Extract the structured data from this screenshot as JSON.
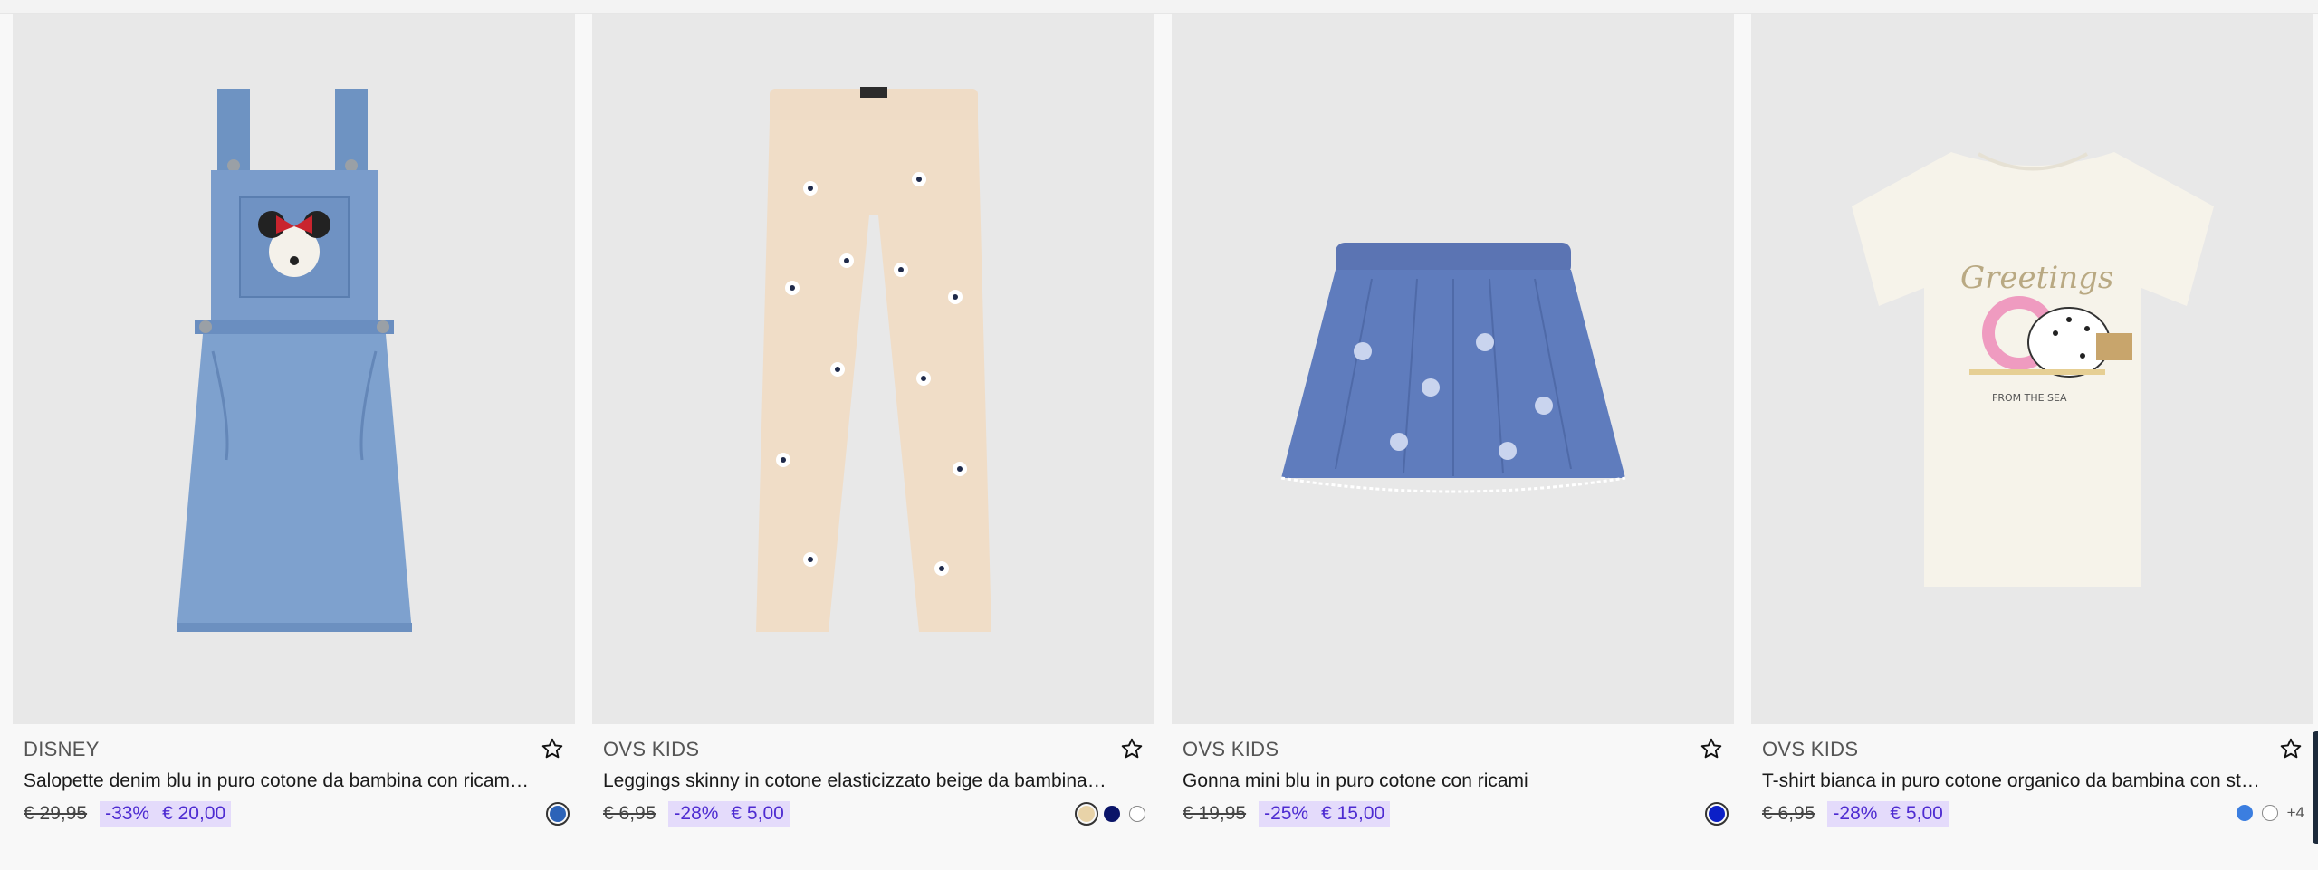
{
  "products": [
    {
      "brand": "DISNEY",
      "title": "Salopette denim blu in puro cotone da bambina con ricami Minnie",
      "old_price": "€ 29,95",
      "discount": "-33%",
      "price": "€ 20,00",
      "image_icon": "denim-dungaree-dress-image",
      "swatches": [
        {
          "color": "#2c63b8",
          "selected": true
        }
      ],
      "more": ""
    },
    {
      "brand": "OVS KIDS",
      "title": "Leggings skinny in cotone elasticizzato beige da bambina con fiori",
      "old_price": "€ 6,95",
      "discount": "-28%",
      "price": "€ 5,00",
      "image_icon": "floral-leggings-image",
      "swatches": [
        {
          "color": "#e8d3a8",
          "selected": true
        },
        {
          "color": "#0a1468",
          "selected": false
        },
        {
          "color": "#ffffff",
          "selected": false
        }
      ],
      "more": ""
    },
    {
      "brand": "OVS KIDS",
      "title": "Gonna mini blu in puro cotone con ricami",
      "old_price": "€ 19,95",
      "discount": "-25%",
      "price": "€ 15,00",
      "image_icon": "blue-mini-skirt-image",
      "swatches": [
        {
          "color": "#0b1fc7",
          "selected": true
        }
      ],
      "more": ""
    },
    {
      "brand": "OVS KIDS",
      "title": "T-shirt bianca in puro cotone organico da bambina con stampa",
      "old_price": "€ 6,95",
      "discount": "-28%",
      "price": "€ 5,00",
      "image_icon": "printed-tshirt-image",
      "swatches": [
        {
          "color": "#3b7ee0",
          "selected": false
        },
        {
          "color": "#ffffff",
          "selected": false
        }
      ],
      "more": "+4"
    }
  ],
  "colors": {
    "promo_bg": "#e4dbfb",
    "promo_text": "#4d2bd1",
    "image_bg": "#e8e8e8"
  }
}
